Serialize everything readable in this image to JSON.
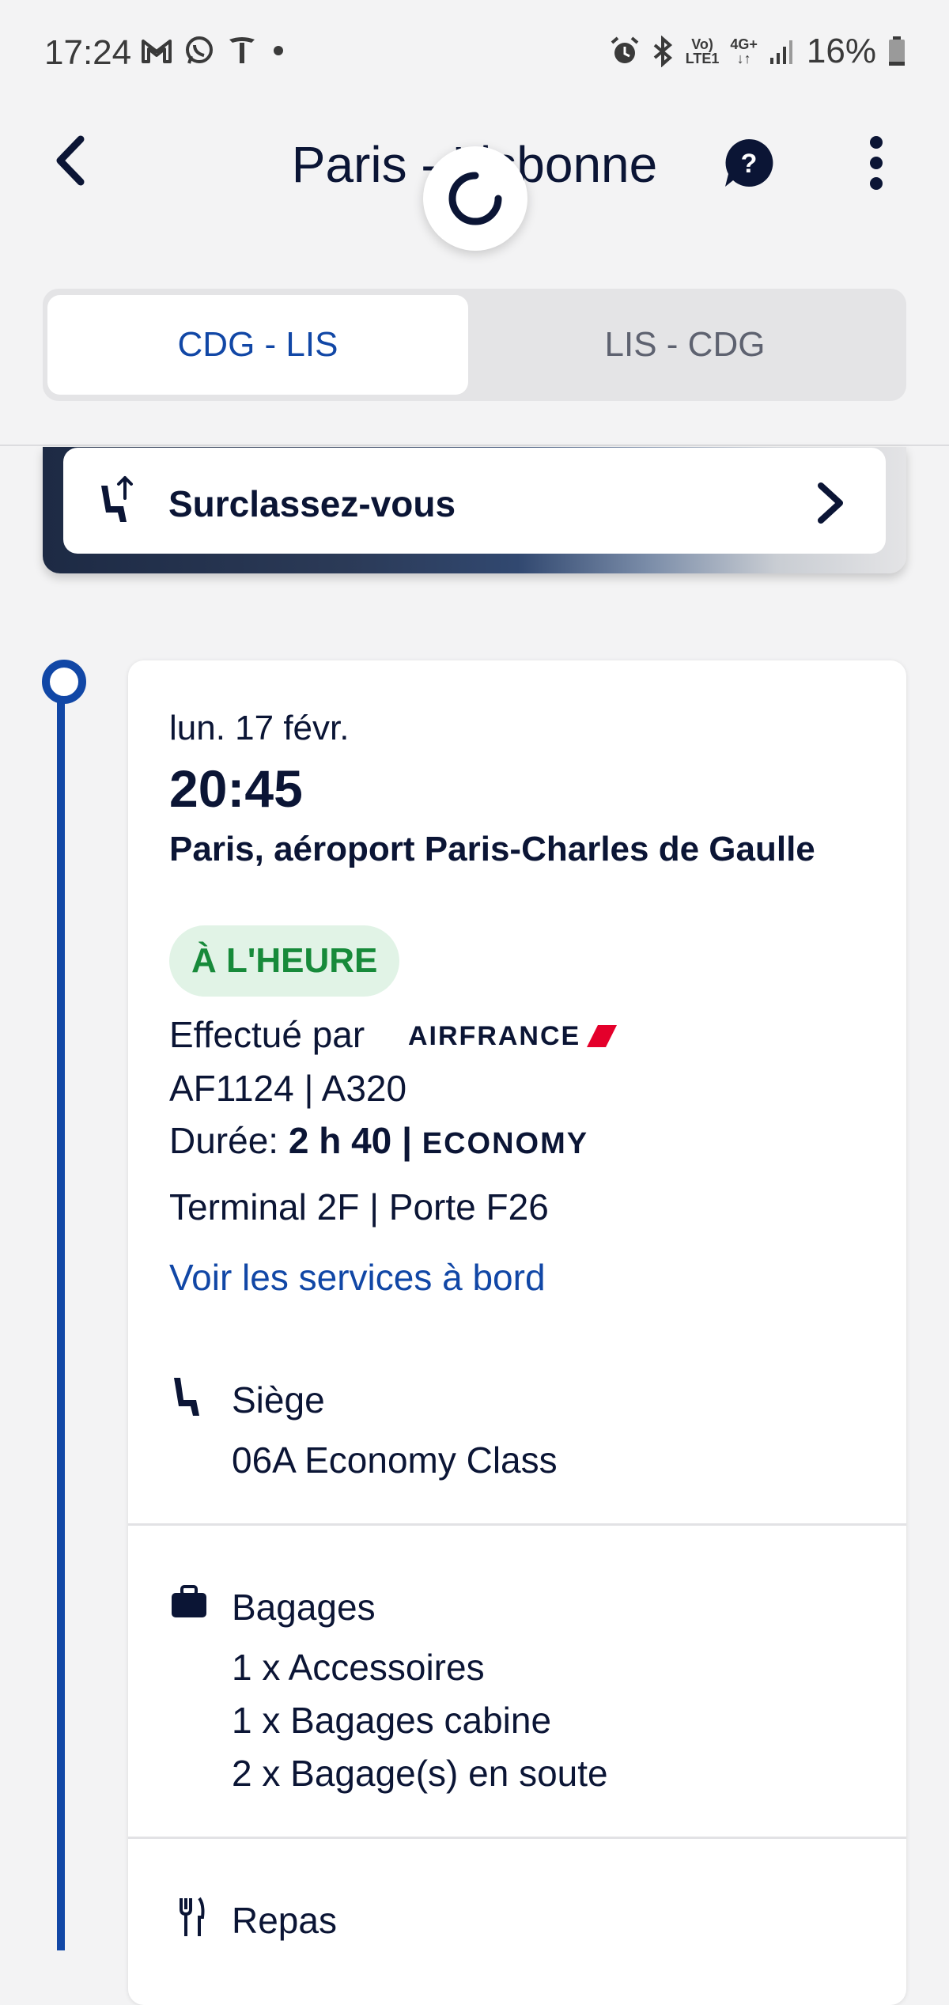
{
  "status_bar": {
    "time": "17:24",
    "network_top": "Vo)",
    "network_bottom": "LTE1",
    "data_type": "4G+",
    "battery": "16%",
    "left_icons": [
      "gmail-icon",
      "whatsapp-icon",
      "tesla-icon",
      "dot-icon"
    ],
    "right_icons": [
      "alarm-icon",
      "bluetooth-icon",
      "signal-icon",
      "battery-icon"
    ]
  },
  "header": {
    "title": "Paris - Lisbonne",
    "icons": [
      "back-arrow-icon",
      "loading-spinner-icon",
      "help-icon",
      "more-options-icon"
    ]
  },
  "tabs": [
    {
      "label": "CDG - LIS",
      "active": true
    },
    {
      "label": "LIS - CDG",
      "active": false
    }
  ],
  "upgrade": {
    "label": "Surclassez-vous",
    "icons": [
      "seat-upgrade-icon",
      "chevron-right-icon"
    ]
  },
  "flight": {
    "date": "lun. 17 févr.",
    "time": "20:45",
    "airport": "Paris, aéroport Paris-Charles de Gaulle",
    "status": "À L'HEURE",
    "operated_by_label": "Effectué par",
    "airline_logo_text": "AIRFRANCE",
    "flight_aircraft": "AF1124 | A320",
    "duration_label": "Durée:",
    "duration_value": "2 h 40",
    "separator": "|",
    "cabin": "ECONOMY",
    "terminal_gate": "Terminal 2F | Porte F26",
    "services_link": "Voir les services à bord"
  },
  "seat": {
    "title": "Siège",
    "value": "06A Economy Class"
  },
  "baggage": {
    "title": "Bagages",
    "items": [
      "1 x Accessoires",
      "1 x Bagages cabine",
      "2 x Bagage(s) en soute"
    ]
  },
  "meal": {
    "title": "Repas"
  },
  "colors": {
    "brand_blue": "#1147a6",
    "text_dark": "#0b1535",
    "on_time_green": "#178a3a",
    "on_time_bg": "#e1f3e6",
    "background": "#f3f3f4",
    "airfrance_red": "#e4002b"
  }
}
